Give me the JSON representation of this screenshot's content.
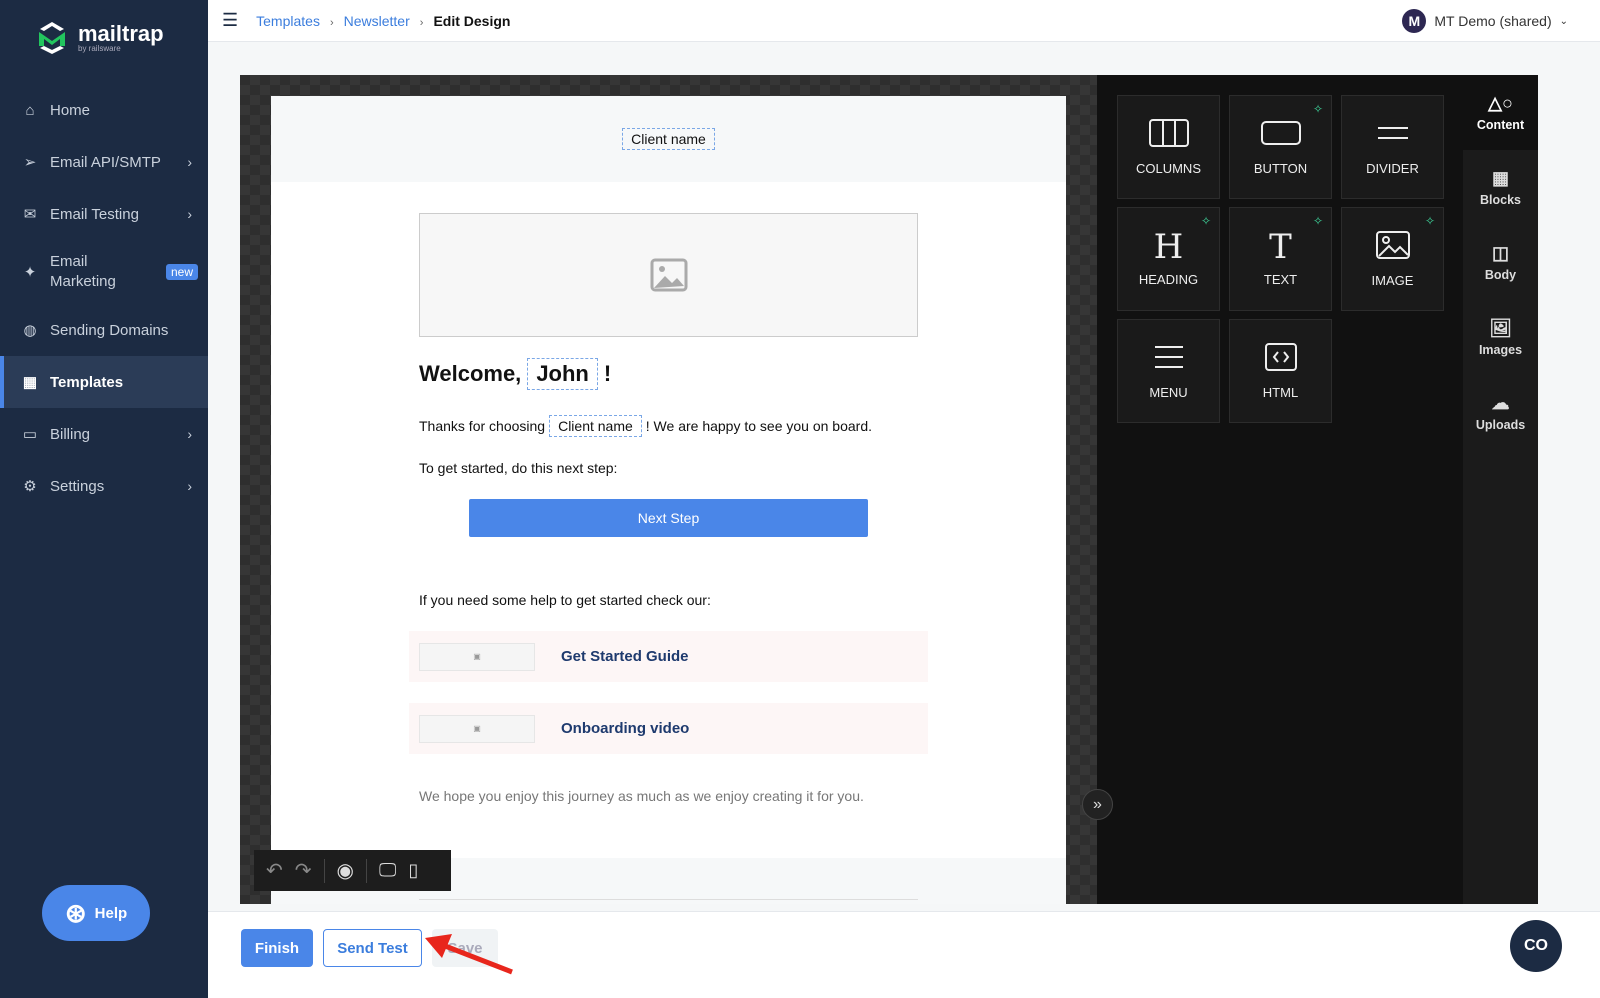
{
  "brand": {
    "name": "mailtrap",
    "tagline": "by railsware",
    "accent": "#4a86e8",
    "sidebar_bg": "#1c2b43"
  },
  "sidebar": {
    "items": [
      {
        "label": "Home",
        "icon": "home-icon"
      },
      {
        "label": "Email API/SMTP",
        "icon": "send-icon",
        "chevron": true
      },
      {
        "label": "Email Testing",
        "icon": "email-testing-icon",
        "chevron": true
      },
      {
        "label": "Email Marketing",
        "icon": "sparkle-icon",
        "badge": "new"
      },
      {
        "label": "Sending Domains",
        "icon": "globe-icon"
      },
      {
        "label": "Templates",
        "icon": "template-icon",
        "active": true
      },
      {
        "label": "Billing",
        "icon": "card-icon",
        "chevron": true
      },
      {
        "label": "Settings",
        "icon": "gear-icon",
        "chevron": true
      }
    ],
    "help": "Help"
  },
  "breadcrumb": [
    "Templates",
    "Newsletter",
    "Edit Design"
  ],
  "user": {
    "initial": "M",
    "name": "MT Demo (shared)"
  },
  "email": {
    "client_tag": "Client name",
    "welcome": "Welcome,",
    "name_tag": "John",
    "exclaim": "!",
    "thanks_pre": "Thanks for choosing",
    "thanks_tag": "Client name",
    "thanks_post": "! We are happy to see you on board.",
    "step": "To get started, do this next step:",
    "button": "Next Step",
    "help": "If you need some help to get started check our:",
    "links": [
      "Get Started Guide",
      "Onboarding video"
    ],
    "footer": "We hope you enjoy this journey as much as we enjoy creating it for you."
  },
  "tiles": [
    {
      "label": "COLUMNS"
    },
    {
      "label": "BUTTON",
      "ai": true
    },
    {
      "label": "DIVIDER"
    },
    {
      "label": "HEADING",
      "ai": true
    },
    {
      "label": "TEXT",
      "ai": true
    },
    {
      "label": "IMAGE",
      "ai": true
    },
    {
      "label": "MENU"
    },
    {
      "label": "HTML"
    }
  ],
  "tabs": [
    "Content",
    "Blocks",
    "Body",
    "Images",
    "Uploads"
  ],
  "actions": {
    "finish": "Finish",
    "send_test": "Send Test",
    "save": "Save"
  }
}
